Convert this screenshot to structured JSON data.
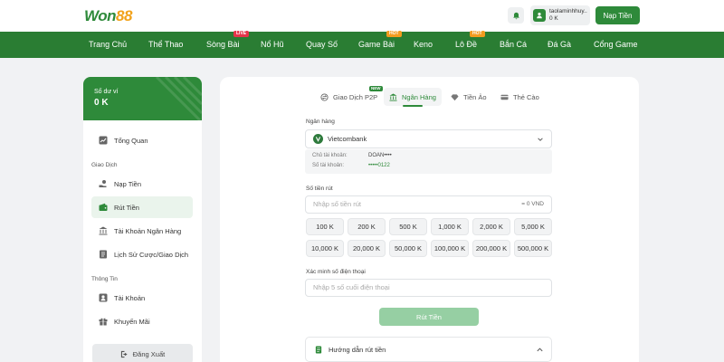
{
  "header": {
    "logo_won": "Won",
    "logo_88": "88",
    "user_name": "taolaminhhuy...",
    "user_balance": "0 K",
    "deposit_label": "Nạp Tiền"
  },
  "nav": {
    "items": [
      {
        "label": "Trang Chủ"
      },
      {
        "label": "Thể Thao"
      },
      {
        "label": "Sòng Bài",
        "badge": "LIVE"
      },
      {
        "label": "Nổ Hũ"
      },
      {
        "label": "Quay Số"
      },
      {
        "label": "Game Bài",
        "badge": "HOT"
      },
      {
        "label": "Keno"
      },
      {
        "label": "Lô Đề",
        "badge": "HOT"
      },
      {
        "label": "Bắn Cá"
      },
      {
        "label": "Đá Gà"
      },
      {
        "label": "Cổng Game"
      }
    ]
  },
  "sidebar": {
    "balance_label": "Số dư ví",
    "balance_value": "0 K",
    "overview": "Tổng Quan",
    "section_transactions": "Giao Dịch",
    "deposit": "Nạp Tiền",
    "withdraw": "Rút Tiền",
    "bank_account": "Tài Khoản Ngân Hàng",
    "history": "Lịch Sử Cược/Giao Dịch",
    "section_info": "Thông Tin",
    "account": "Tài Khoản",
    "promotions": "Khuyến Mãi",
    "logout": "Đăng Xuất"
  },
  "tabs": [
    {
      "label": "Giao Dịch P2P",
      "badge": "NEW"
    },
    {
      "label": "Ngân Hàng"
    },
    {
      "label": "Tiền Ảo"
    },
    {
      "label": "Thẻ Cào"
    }
  ],
  "form": {
    "bank_label": "Ngân hàng",
    "bank_selected": "Vietcombank",
    "holder_label": "Chủ tài khoản:",
    "holder_value": "DOAN••••",
    "account_label": "Số tài khoản:",
    "account_value": "•••••0122",
    "amount_label": "Số tiền rút",
    "amount_placeholder": "Nhập số tiền rút",
    "amount_equiv": "= 0 VND",
    "quick_amounts": [
      "100 K",
      "200 K",
      "500 K",
      "1,000 K",
      "2,000 K",
      "5,000 K",
      "10,000 K",
      "20,000 K",
      "50,000 K",
      "100,000 K",
      "200,000 K",
      "500,000 K"
    ],
    "phone_label": "Xác minh số điện thoại",
    "phone_placeholder": "Nhập 5 số cuối điện thoại",
    "submit_label": "Rút Tiền",
    "guide_label": "Hướng dẫn rút tiền"
  },
  "colors": {
    "primary": "#2e8a3a",
    "nav_bg": "#2a7d33",
    "accent_orange": "#f2a21b",
    "badge_live": "#e6344a",
    "badge_hot": "#f39b1e"
  }
}
